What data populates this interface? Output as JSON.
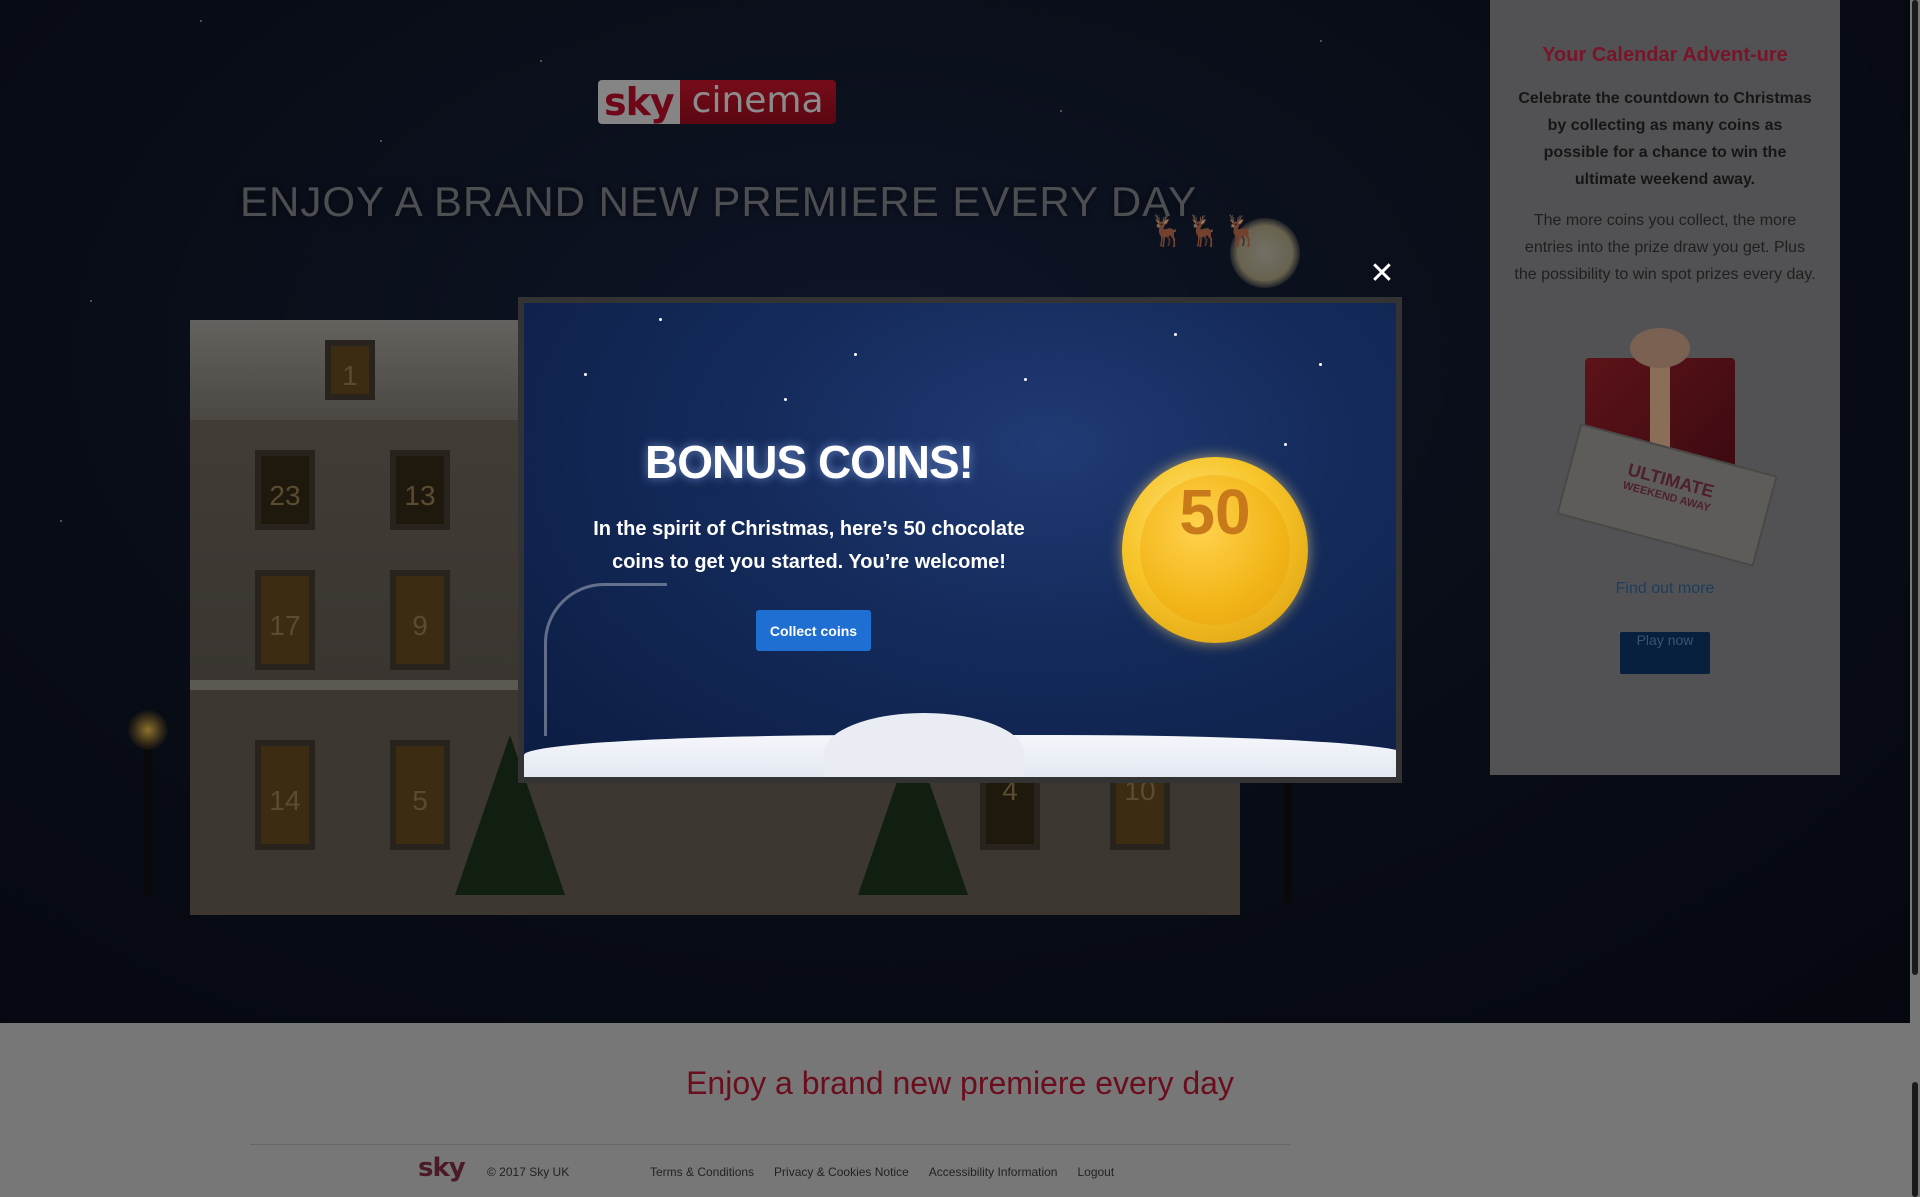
{
  "hero": {
    "logo_sky": "sky",
    "logo_cinema": "cinema",
    "title": "ENJOY A BRAND NEW PREMIERE EVERY DAY",
    "window_numbers": [
      "1",
      "23",
      "13",
      "17",
      "9",
      "14",
      "5",
      "4",
      "10"
    ]
  },
  "sidebar": {
    "title": "Your Calendar Advent-ure",
    "lead": "Celebrate the countdown to Christmas by collecting as many coins as possible for a chance to win the ultimate weekend away.",
    "body": "The more coins you collect, the more entries into the prize draw you get. Plus the possibility to win spot prizes every day.",
    "ticket_line1": "ULTIMATE",
    "ticket_line2": "WEEKEND AWAY",
    "find_more": "Find out more",
    "play_now": "Play now"
  },
  "modal": {
    "title": "BONUS COINS!",
    "text": "In the spirit of Christmas, here’s 50 chocolate coins to get you started. You’re welcome!",
    "button": "Collect coins",
    "coin_value": "50",
    "close_icon": "close-icon"
  },
  "footer": {
    "title": "Enjoy a brand new premiere every day",
    "logo": "sky",
    "copyright": "© 2017 Sky UK",
    "links": [
      "Terms & Conditions",
      "Privacy & Cookies Notice",
      "Accessibility Information",
      "Logout"
    ]
  },
  "colors": {
    "brand_red": "#c8102e",
    "button_blue": "#1f6fd2",
    "coin_gold": "#f7c52a"
  }
}
